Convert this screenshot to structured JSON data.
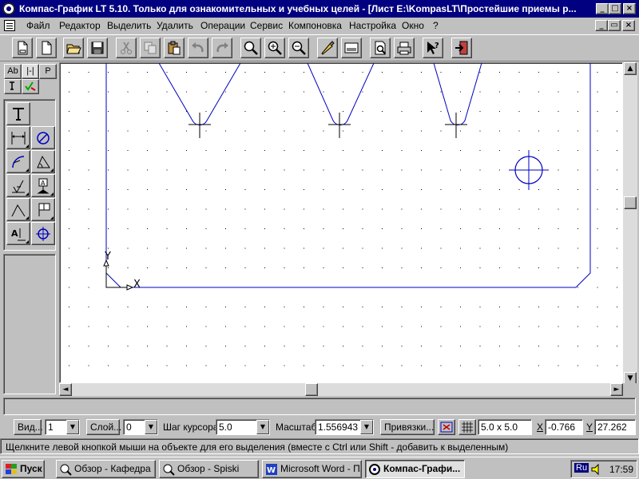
{
  "title_bar": {
    "title": "Компас-График LT 5.10. Только для ознакомительных и учебных целей - [Лист E:\\KompasLT\\Простейшие приемы р...",
    "buttons": {
      "minimize": "_",
      "maximize": "□",
      "close": "×"
    }
  },
  "menu": {
    "items": [
      {
        "label": "Файл"
      },
      {
        "label": "Редактор"
      },
      {
        "label": "Выделить"
      },
      {
        "label": "Удалить"
      },
      {
        "label": "Операции"
      },
      {
        "label": "Сервис"
      },
      {
        "label": "Компоновка"
      },
      {
        "label": "Настройка"
      },
      {
        "label": "Окно"
      },
      {
        "label": "?"
      }
    ],
    "doc_buttons": {
      "minimize": "_",
      "restore": "▭",
      "close": "×"
    }
  },
  "toolbar": {
    "icons": [
      "new-sheet-icon",
      "new-document-icon",
      "open-folder-icon",
      "save-icon",
      "cut-icon",
      "copy-icon",
      "paste-icon",
      "undo-icon",
      "redo-icon",
      "zoom-window-icon",
      "zoom-in-icon",
      "zoom-out-icon",
      "pan-icon",
      "show-all-icon",
      "preview-icon",
      "print-icon",
      "help-pointer-icon",
      "exit-icon"
    ]
  },
  "left_panel": {
    "tabs": [
      {
        "label": "Ab"
      },
      {
        "label": "|-|"
      },
      {
        "label": "P"
      }
    ]
  },
  "canvas": {
    "axis_y_label": "Y",
    "axis_x_label": "X"
  },
  "property_bar": {
    "view_button": "Вид...",
    "view_value": "1",
    "layer_button": "Слой...",
    "layer_value": "0",
    "cursor_step_label": "Шаг курсора",
    "cursor_step_value": "5.0",
    "scale_label": "Масштаб",
    "scale_value": "1.556943",
    "snaps_button": "Привязки...",
    "grid_value": "5.0 x 5.0",
    "x_label": "X",
    "x_value": "-0.766",
    "y_label": "Y",
    "y_value": "27.262"
  },
  "status_bar": {
    "text": "Щелкните левой кнопкой мыши на объекте для его выделения (вместе с Ctrl или Shift - добавить к выделенным)"
  },
  "taskbar": {
    "start_label": "Пуск",
    "tasks": [
      {
        "label": "Обзор - Кафедра"
      },
      {
        "label": "Обзор - Spiski"
      },
      {
        "label": "Microsoft Word - П..."
      },
      {
        "label": "Компас-Графи..."
      }
    ],
    "language": "Ru",
    "clock": "17:59"
  },
  "colors": {
    "title_bar": "#000080",
    "drawing_lines": "#0000c0",
    "canvas_bg": "#ffffff",
    "face": "#c0c0c0"
  }
}
